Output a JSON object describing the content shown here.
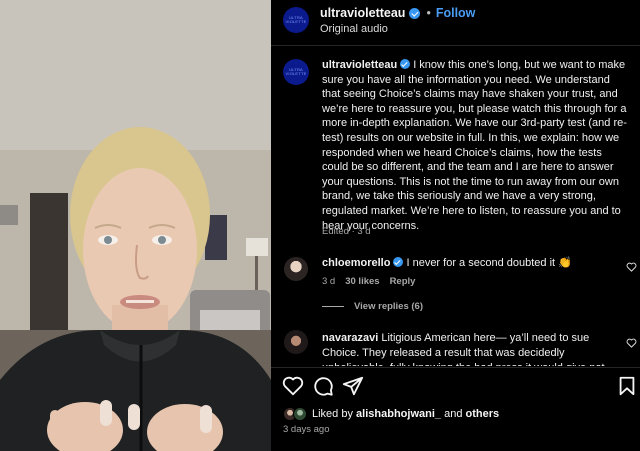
{
  "header": {
    "username": "ultravioletteau",
    "follow_label": "Follow",
    "separator": "•",
    "audio": "Original audio",
    "avatar_text": "ULTRA VIOLETTE"
  },
  "caption": {
    "username": "ultravioletteau",
    "text": "I know this one’s long, but we want to make sure you have all the information you need. We understand that seeing Choice’s claims may have shaken your trust, and we’re here to reassure you, but please watch this through for a more in-depth explanation. We have our 3rd-party test (and re-test) results on our website in full. In this, we explain: how we responded when we heard Choice’s claims, how the tests could be so different, and the team and I are here to answer your questions. This is not the time to run away from our own brand, we take this seriously and we have a very strong, regulated market. We’re here to listen, to reassure you and to hear your concerns.",
    "meta": "Edited · 3 d"
  },
  "comments": [
    {
      "username": "chloemorello",
      "text": "I never for a second doubted it 👏",
      "age": "3 d",
      "likes": "30 likes",
      "reply": "Reply",
      "view_replies": "View replies (6)"
    },
    {
      "username": "navarazavi",
      "text": "Litigious American here— ya’ll need to sue Choice. They released a result that was decidedly unbelievable, fully knowing the bad press it would give not"
    }
  ],
  "likes": {
    "prefix": "Liked by",
    "user": "alishabhojwani_",
    "conj": "and",
    "others": "others"
  },
  "timestamp": "3 days ago",
  "icons": {
    "like": "heart-icon",
    "comment": "comment-icon",
    "share": "paper-plane-icon",
    "save": "bookmark-icon"
  },
  "colors": {
    "accent": "#4a9cf5",
    "verified": "#3897f0",
    "avatar_brand": "#0b1a8c"
  }
}
